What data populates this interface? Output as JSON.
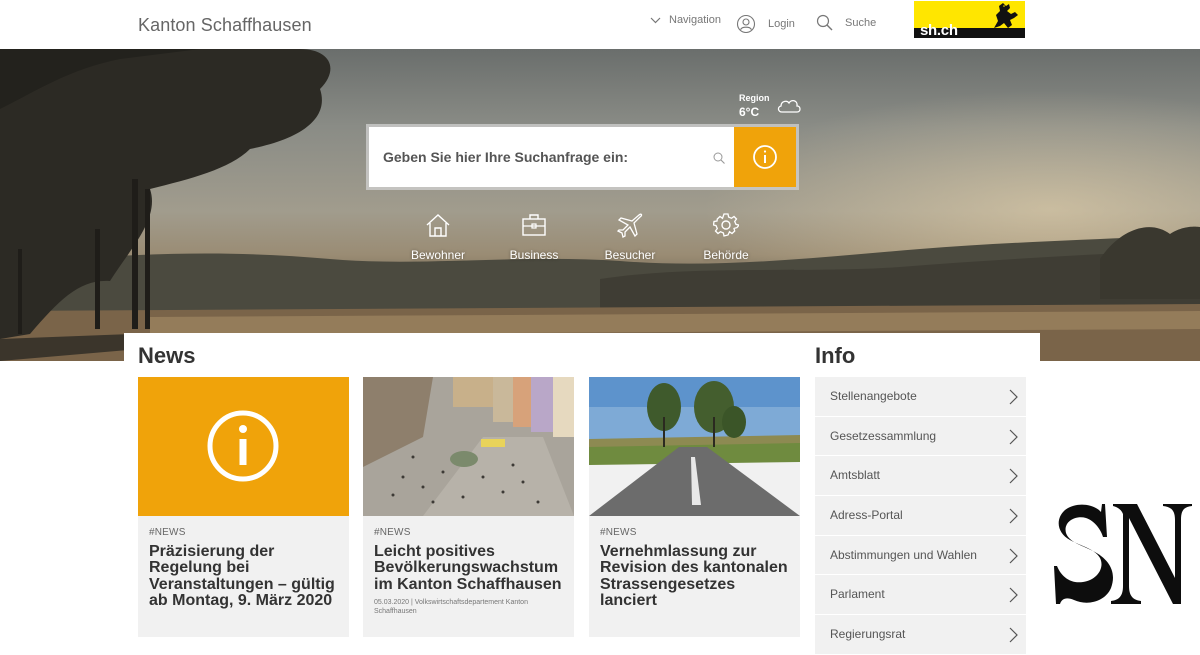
{
  "header": {
    "site_title": "Kanton Schaffhausen",
    "nav": [
      {
        "label": "Navigation",
        "icon": "chevron-down-icon"
      },
      {
        "label": "Login",
        "icon": "user-icon"
      },
      {
        "label": "Suche",
        "icon": "search-icon"
      }
    ],
    "logo_text": "sh.ch"
  },
  "hero": {
    "weather": {
      "label": "Region",
      "temp": "6°C",
      "icon": "cloud-icon"
    },
    "search": {
      "placeholder": "Geben Sie hier Ihre Suchanfrage ein:",
      "button_icon": "info-icon"
    },
    "categories": [
      {
        "label": "Bewohner",
        "icon": "house-icon"
      },
      {
        "label": "Business",
        "icon": "briefcase-icon"
      },
      {
        "label": "Besucher",
        "icon": "airplane-icon"
      },
      {
        "label": "Behörde",
        "icon": "gear-icon"
      }
    ]
  },
  "news": {
    "title": "News",
    "cards": [
      {
        "tag": "#NEWS",
        "title": "Präzisierung der Regelung bei Veranstaltungen – gültig ab Montag, 9. März 2020",
        "meta": ""
      },
      {
        "tag": "#NEWS",
        "title": "Leicht positives Bevölkerungswachstum im Kanton Schaffhausen",
        "meta": "05.03.2020 | Volkswirtschaftsdepartement Kanton Schaffhausen"
      },
      {
        "tag": "#NEWS",
        "title": "Vernehmlassung zur Revision des kantonalen Strassengesetzes lanciert",
        "meta": ""
      }
    ]
  },
  "info": {
    "title": "Info",
    "items": [
      "Stellenangebote",
      "Gesetzessammlung",
      "Amtsblatt",
      "Adress-Portal",
      "Abstimmungen und Wahlen",
      "Parlament",
      "Regierungsrat"
    ]
  },
  "colors": {
    "accent": "#f0a30a",
    "logo_yellow": "#ffe600",
    "card_bg": "#f1f1f1"
  }
}
